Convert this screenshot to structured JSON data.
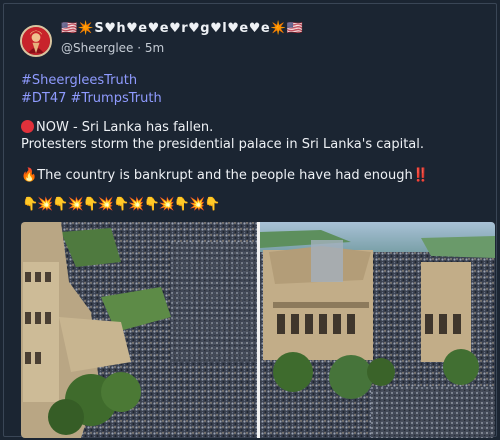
{
  "user": {
    "display_name": "🇺🇸✴️S♥h♥e♥e♥r♥g♥l♥e♥e✴️🇺🇸",
    "handle": "@Sheerglee",
    "separator": "·",
    "time": "5m"
  },
  "hashtags": [
    "#SheergleesTruth",
    "#DT47",
    "#TrumpsTruth"
  ],
  "post": {
    "line1": "NOW - Sri Lanka has fallen.",
    "line2": "Protesters storm the presidential palace in Sri Lanka's capital.",
    "line3": "The country is bankrupt and the people have had enough",
    "line3_suffix": "‼️",
    "fire": "🔥",
    "emoji_row": "👇💥👇💥👇💥👇💥👇💥👇💥👇"
  },
  "colors": {
    "background": "#1b2532",
    "hashtag": "#8f9bff",
    "text": "#eef1f5",
    "muted": "#c4cbd4"
  }
}
